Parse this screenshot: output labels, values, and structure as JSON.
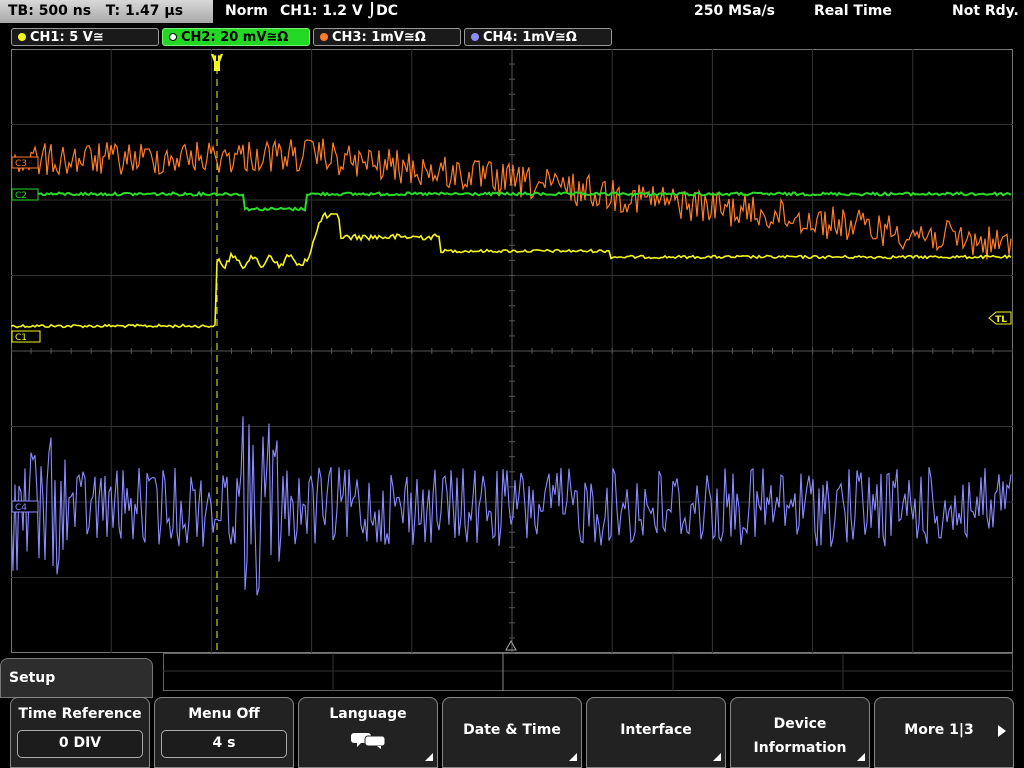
{
  "status": {
    "timebase": "TB: 500 ns",
    "trigger_time": "T: 1.47 µs",
    "trigger_mode": "Norm",
    "trigger_info": "CH1: 1.2 V ⌡DC",
    "sample_rate": "250 MSa/s",
    "acquisition_mode": "Real Time",
    "ready_state": "Not Rdy."
  },
  "channels": [
    {
      "label": "CH1: 5 V≅",
      "color": "#f5f51e"
    },
    {
      "label": "CH2: 20 mV≅Ω",
      "color": "#2bd92b"
    },
    {
      "label": "CH3: 1mV≅Ω",
      "color": "#ff7e2a"
    },
    {
      "label": "CH4: 1mV≅Ω",
      "color": "#8b8bff"
    }
  ],
  "markers": {
    "c1": "C1",
    "c2": "C2",
    "c3": "C3",
    "c4": "C4",
    "trigger_level": "TL",
    "trigger_time": "T"
  },
  "menu": {
    "title": "Setup",
    "softkeys": [
      {
        "label": "Time Reference",
        "value": "0 DIV"
      },
      {
        "label": "Menu Off",
        "value": "4 s"
      },
      {
        "label": "Language",
        "icon": "speech-bubbles-icon"
      },
      {
        "label": "Date & Time"
      },
      {
        "label": "Interface"
      },
      {
        "label": "Device",
        "label2": "Information"
      },
      {
        "label": "More 1|3"
      }
    ]
  }
}
